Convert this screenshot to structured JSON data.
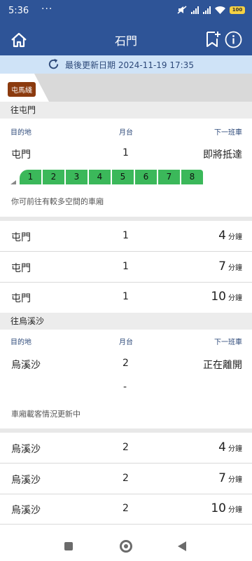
{
  "status_bar": {
    "time": "5:36",
    "overflow": "···",
    "battery": "100",
    "icons": [
      "mute-icon",
      "signal-icon",
      "signal-icon",
      "wifi-icon",
      "battery-icon"
    ]
  },
  "app_bar": {
    "title": "石門",
    "icons": [
      "home-icon",
      "bookmark-add-icon",
      "info-icon"
    ]
  },
  "update": {
    "text": "最後更新日期 2024-11-19 17:35",
    "icon": "refresh-icon"
  },
  "line_tab": {
    "label": "屯馬綫",
    "color": "#8b3a0e"
  },
  "sections": [
    {
      "header": "往屯門",
      "columns": {
        "destination": "目的地",
        "platform": "月台",
        "next": "下一班車"
      },
      "first": {
        "destination": "屯門",
        "platform": "1",
        "eta": "即將抵達"
      },
      "cars": [
        "1",
        "2",
        "3",
        "4",
        "5",
        "6",
        "7",
        "8"
      ],
      "note": "你可前往有較多空間的車廂",
      "rows": [
        {
          "destination": "屯門",
          "platform": "1",
          "minutes": "4",
          "unit": "分鐘"
        },
        {
          "destination": "屯門",
          "platform": "1",
          "minutes": "7",
          "unit": "分鐘"
        },
        {
          "destination": "屯門",
          "platform": "1",
          "minutes": "10",
          "unit": "分鐘"
        }
      ]
    },
    {
      "header": "往烏溪沙",
      "columns": {
        "destination": "目的地",
        "platform": "月台",
        "next": "下一班車"
      },
      "first": {
        "destination": "烏溪沙",
        "platform": "2",
        "eta": "正在離開"
      },
      "dash": "-",
      "note": "車廂載客情況更新中",
      "rows": [
        {
          "destination": "烏溪沙",
          "platform": "2",
          "minutes": "4",
          "unit": "分鐘"
        },
        {
          "destination": "烏溪沙",
          "platform": "2",
          "minutes": "7",
          "unit": "分鐘"
        },
        {
          "destination": "烏溪沙",
          "platform": "2",
          "minutes": "10",
          "unit": "分鐘"
        }
      ]
    }
  ],
  "colors": {
    "primary": "#2e5497",
    "car_green": "#3bb85a",
    "banner": "#cfe3f7"
  }
}
